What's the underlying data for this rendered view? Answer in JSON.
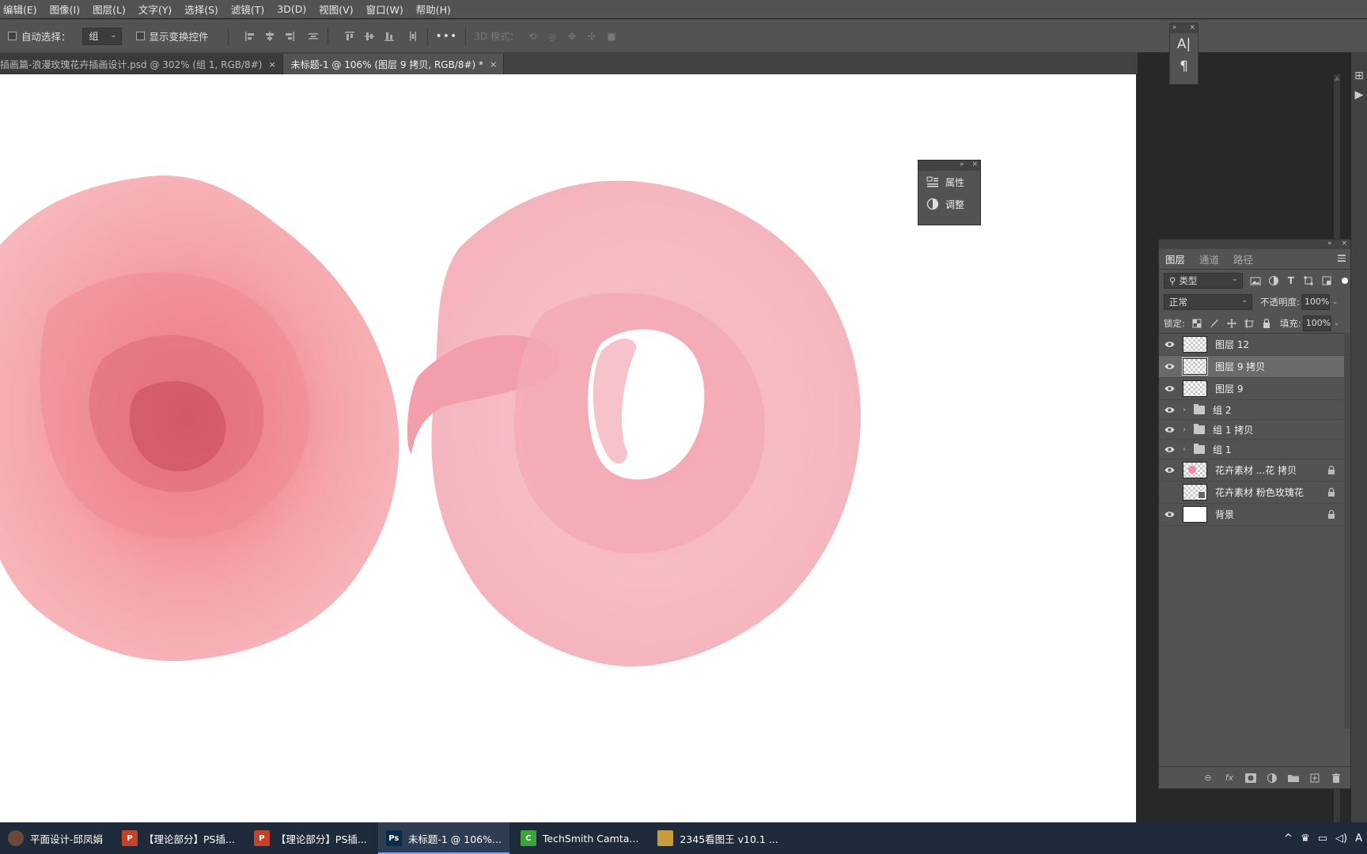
{
  "menu": [
    "编辑(E)",
    "图像(I)",
    "图层(L)",
    "文字(Y)",
    "选择(S)",
    "滤镜(T)",
    "3D(D)",
    "视图(V)",
    "窗口(W)",
    "帮助(H)"
  ],
  "options": {
    "auto_select_label": "自动选择：",
    "auto_select_value": "组",
    "show_transform_label": "显示变换控件",
    "more": "•••",
    "mode_3d": "3D 模式："
  },
  "tabs": [
    {
      "label": "插画篇-浪漫玫瑰花卉插画设计.psd @ 302% (组 1, RGB/8#)",
      "close": "×"
    },
    {
      "label": "未标题-1 @ 106% (图层 9 拷贝, RGB/8#) *",
      "close": "×"
    }
  ],
  "mini_panel": {
    "icon1": "A|",
    "icon2": "¶"
  },
  "props_panel": {
    "properties": "属性",
    "adjustments": "调整"
  },
  "layers_panel": {
    "tabs": [
      "图层",
      "通道",
      "路径"
    ],
    "filter_kind": "类型",
    "blend_mode": "正常",
    "opacity_label": "不透明度:",
    "opacity_value": "100%",
    "lock_label": "锁定:",
    "fill_label": "填充:",
    "fill_value": "100%",
    "layers": [
      {
        "name": "图层 12",
        "type": "pixel",
        "visible": true,
        "locked": false,
        "selected": false
      },
      {
        "name": "图层 9 拷贝",
        "type": "pixel",
        "visible": true,
        "locked": false,
        "selected": true
      },
      {
        "name": "图层 9",
        "type": "pixel",
        "visible": true,
        "locked": false,
        "selected": false
      },
      {
        "name": "组 2",
        "type": "group",
        "visible": true,
        "locked": false,
        "selected": false
      },
      {
        "name": "组 1 拷贝",
        "type": "group",
        "visible": true,
        "locked": false,
        "selected": false
      },
      {
        "name": "组 1",
        "type": "group",
        "visible": true,
        "locked": false,
        "selected": false
      },
      {
        "name": "花卉素材 ...花 拷贝",
        "type": "rose",
        "visible": true,
        "locked": true,
        "selected": false
      },
      {
        "name": "花卉素材 粉色玫瑰花",
        "type": "smart",
        "visible": false,
        "locked": true,
        "selected": false
      },
      {
        "name": "背景",
        "type": "background",
        "visible": true,
        "locked": true,
        "selected": false
      }
    ]
  },
  "taskbar": [
    {
      "label": "平面设计-邱凤娟",
      "icon": "avatar",
      "color": "#6b4a3a"
    },
    {
      "label": "【理论部分】PS插...",
      "icon": "P",
      "color": "#c4432b"
    },
    {
      "label": "【理论部分】PS插...",
      "icon": "P",
      "color": "#c4432b"
    },
    {
      "label": "未标题-1 @ 106%...",
      "icon": "Ps",
      "color": "#0a2a4a",
      "active": true
    },
    {
      "label": "TechSmith Camta...",
      "icon": "C",
      "color": "#3aa63a"
    },
    {
      "label": "2345看图王 v10.1 ...",
      "icon": "img",
      "color": "#c89b3c"
    }
  ],
  "tray": {
    "chevron": "^",
    "ime": "A"
  },
  "colors": {
    "ui_bg": "#535353",
    "canvas": "#ffffff",
    "rose_left": "#f4a3a8",
    "rose_right": "#f6b8c0",
    "taskbar": "#1f2b3a"
  }
}
